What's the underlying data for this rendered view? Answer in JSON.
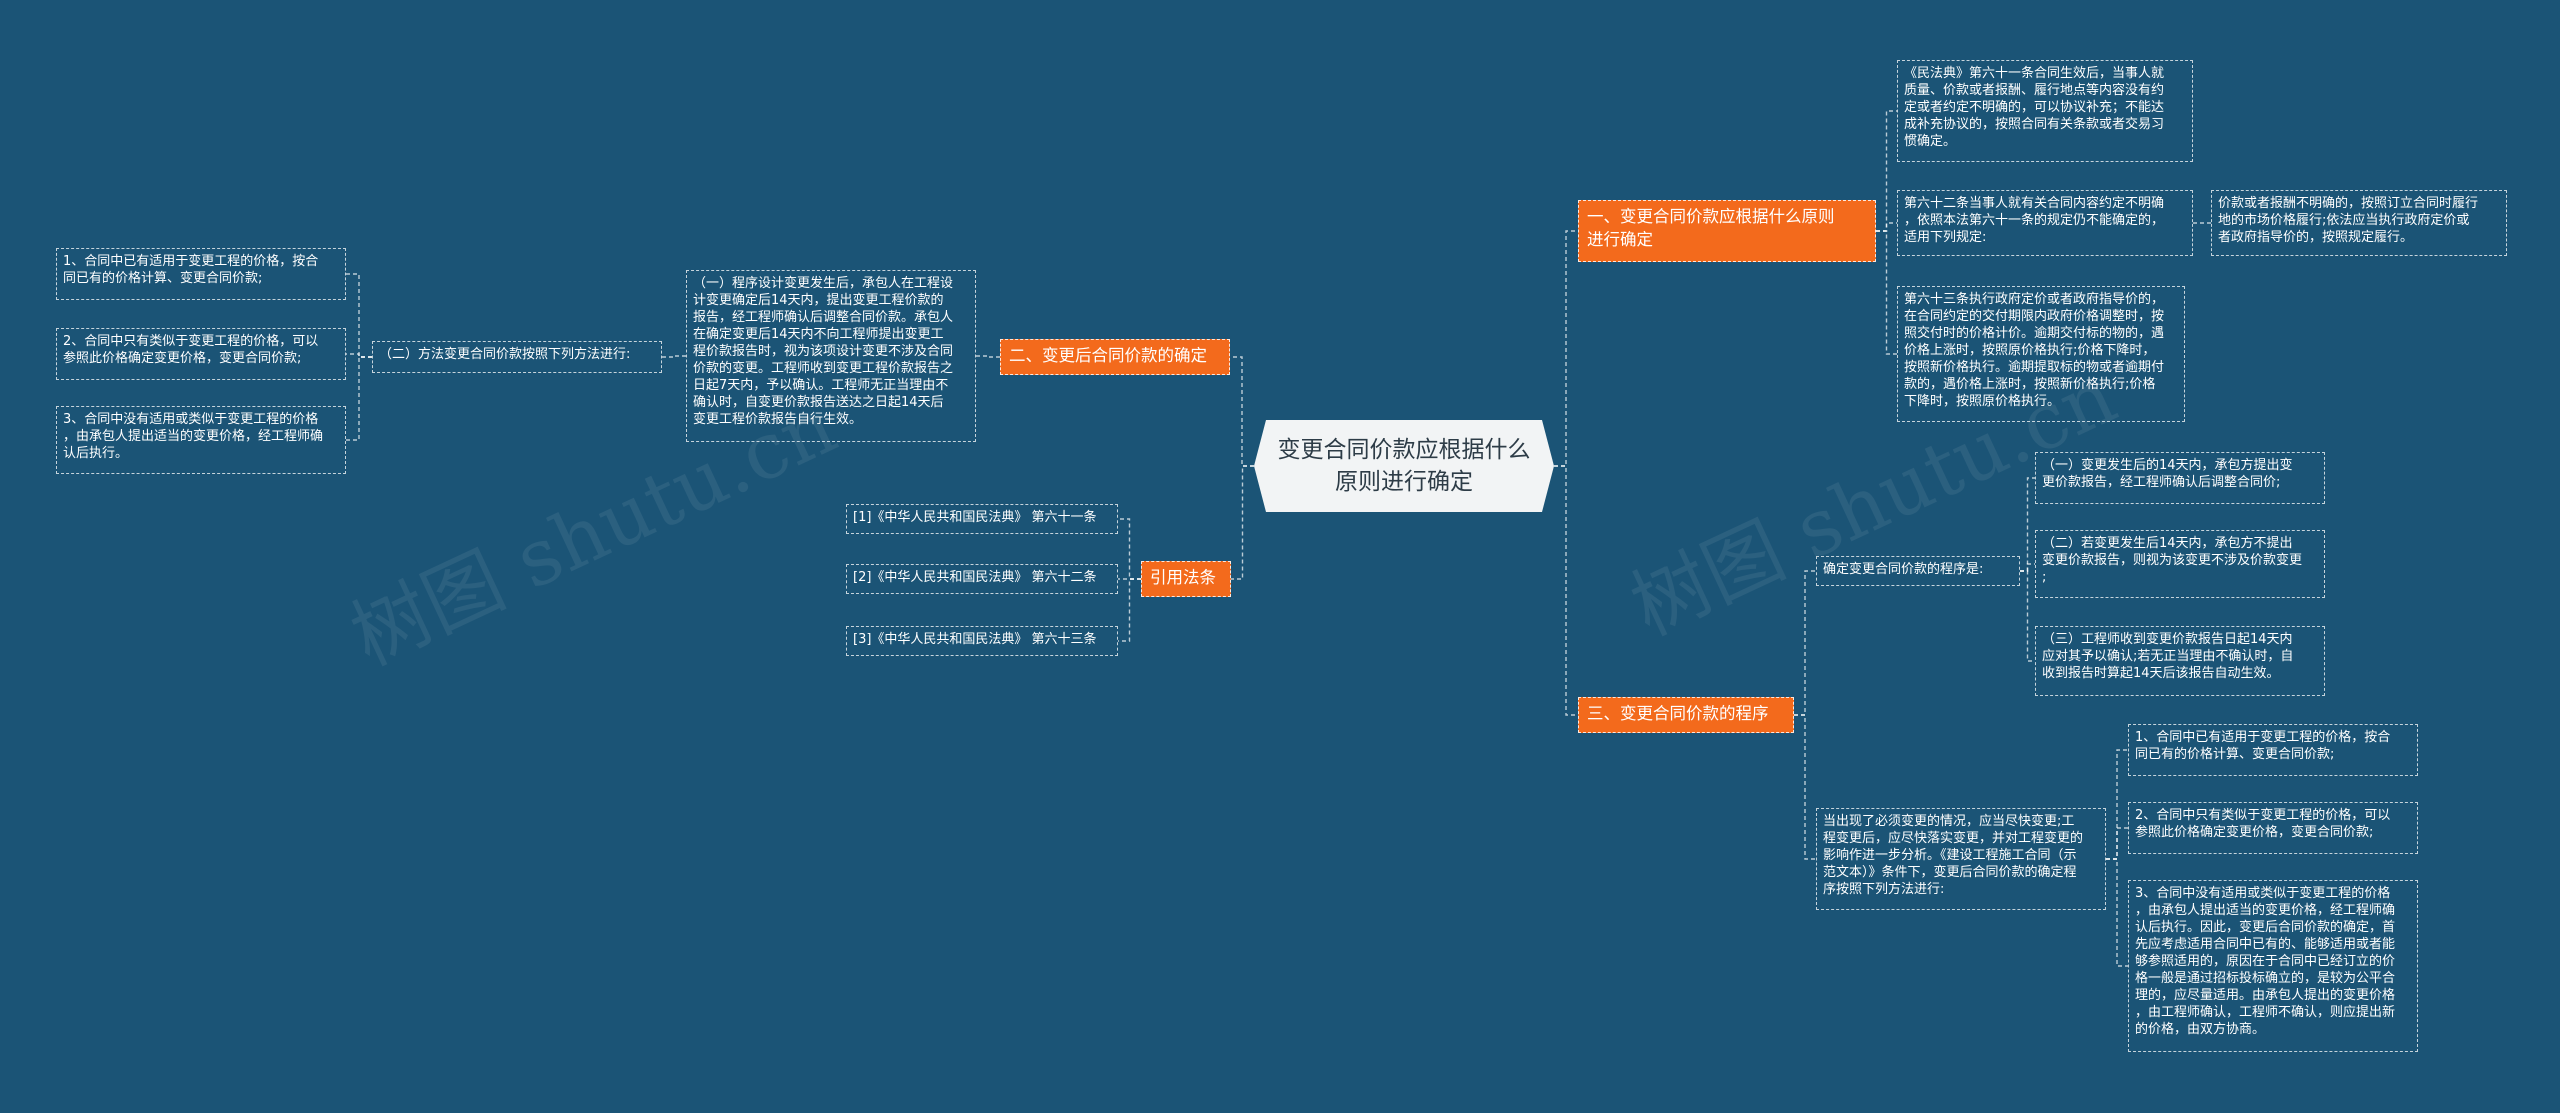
{
  "root": {
    "text": "变更合同价款应根据什么\n原则进行确定"
  },
  "watermarks": {
    "left": "树图 shutu.cn",
    "right": "树图 shutu.cn"
  },
  "branches": {
    "b1": "一、变更合同价款应根据什么原则\n进行确定",
    "b2": "二、变更后合同价款的确定",
    "b3": "引用法条",
    "b4": "三、变更合同价款的程序"
  },
  "b1_leaves": {
    "l1": "《民法典》第六十一条合同生效后，当事人就\n质量、价款或者报酬、履行地点等内容没有约\n定或者约定不明确的，可以协议补充；不能达\n成补充协议的，按照合同有关条款或者交易习\n惯确定。",
    "l2": "第六十二条当事人就有关合同内容约定不明确\n，依照本法第六十一条的规定仍不能确定的，\n适用下列规定:",
    "l2a": "价款或者报酬不明确的，按照订立合同时履行\n地的市场价格履行;依法应当执行政府定价或\n者政府指导价的，按照规定履行。",
    "l3": "第六十三条执行政府定价或者政府指导价的，\n在合同约定的交付期限内政府价格调整时，按\n照交付时的价格计价。逾期交付标的物的，遇\n价格上涨时，按照原价格执行;价格下降时，\n按照新价格执行。逾期提取标的物或者逾期付\n款的，遇价格上涨时，按照新价格执行;价格\n下降时，按照原价格执行。"
  },
  "b2_content": {
    "main": "（一）程序设计变更发生后，承包人在工程设\n计变更确定后14天内，提出变更工程价款的\n报告，经工程师确认后调整合同价款。承包人\n在确定变更后14天内不向工程师提出变更工\n程价款报告时，视为该项设计变更不涉及合同\n价款的变更。工程师收到变更工程价款报告之\n日起7天内，予以确认。工程师无正当理由不\n确认时，自变更价款报告送达之日起14天后\n变更工程价款报告自行生效。",
    "method": "（二）方法变更合同价款按照下列方法进行:",
    "m1": "1、合同中已有适用于变更工程的价格，按合\n同已有的价格计算、变更合同价款;",
    "m2": "2、合同中只有类似于变更工程的价格，可以\n参照此价格确定变更价格，变更合同价款;",
    "m3": "3、合同中没有适用或类似于变更工程的价格\n，由承包人提出适当的变更价格，经工程师确\n认后执行。"
  },
  "b3_laws": {
    "c1": "[1]《中华人民共和国民法典》 第六十一条",
    "c2": "[2]《中华人民共和国民法典》 第六十二条",
    "c3": "[3]《中华人民共和国民法典》 第六十三条"
  },
  "b4_content": {
    "proc": "确定变更合同价款的程序是:",
    "p1": "（一）变更发生后的14天内，承包方提出变\n更价款报告，经工程师确认后调整合同价;",
    "p2": "（二）若变更发生后14天内，承包方不提出\n变更价款报告，则视为该变更不涉及价款变更\n;",
    "p3": "（三）工程师收到变更价款报告日起14天内\n应对其予以确认;若无正当理由不确认时，自\n收到报告时算起14天后该报告自动生效。",
    "must": "当出现了必须变更的情况，应当尽快变更;工\n程变更后，应尽快落实变更，并对工程变更的\n影响作进一步分析。《建设工程施工合同（示\n范文本）》条件下，变更后合同价款的确定程\n序按照下列方法进行:",
    "n1": "1、合同中已有适用于变更工程的价格，按合\n同已有的价格计算、变更合同价款;",
    "n2": "2、合同中只有类似于变更工程的价格，可以\n参照此价格确定变更价格，变更合同价款;",
    "n3": "3、合同中没有适用或类似于变更工程的价格\n，由承包人提出适当的变更价格，经工程师确\n认后执行。因此，变更后合同价款的确定，首\n先应考虑适用合同中已有的、能够适用或者能\n够参照适用的，原因在于合同中已经订立的价\n格一般是通过招标投标确立的，是较为公平合\n理的，应尽量适用。由承包人提出的变更价格\n，由工程师确认，工程师不确认，则应提出新\n的价格，由双方协商。"
  }
}
